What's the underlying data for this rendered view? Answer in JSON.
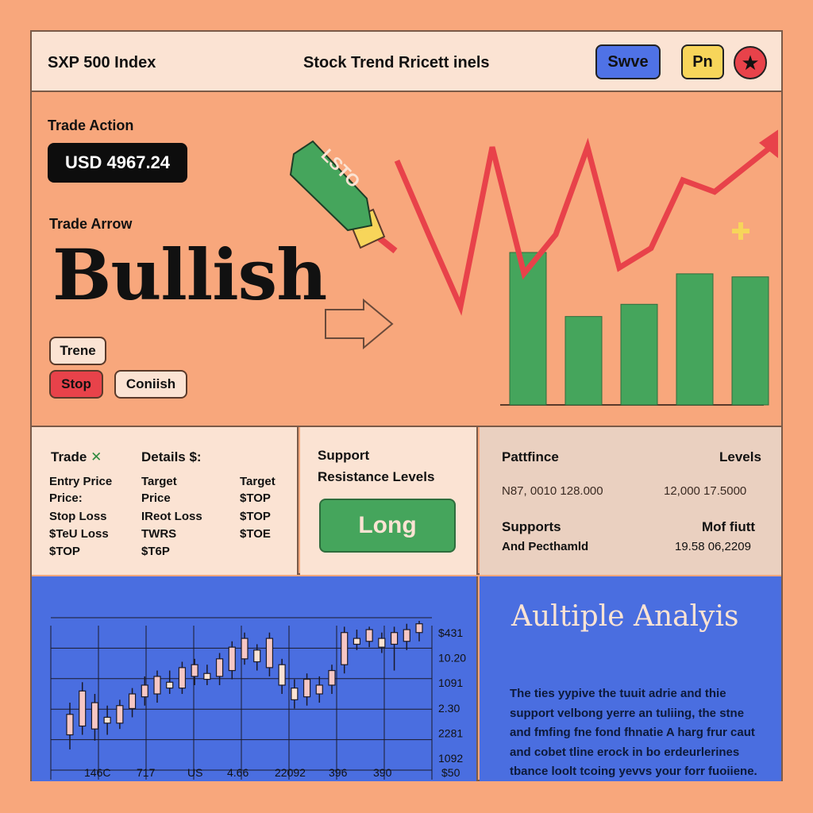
{
  "header": {
    "app_title": "SXP 500 Index",
    "window_title": "Stock Trend Rricett inels",
    "save_label": "Swve",
    "pn_label": "Pn",
    "close_glyph": "★"
  },
  "trade": {
    "action_label": "Trade Action",
    "price": "USD 4967.24",
    "arrow_label": "Trade Arrow",
    "signal": "Bullish",
    "chips": {
      "trend": "Trene",
      "stop": "Stop",
      "confirm": "Coniish"
    },
    "tag_label": "LSTO"
  },
  "details": {
    "col1_header": "Trade",
    "col1_mark": "✕",
    "col2_header": "Details $:",
    "col1": [
      "Entry Price",
      "Price:",
      "Stop Loss",
      "$TeU Loss",
      "$TOP"
    ],
    "col2": [
      "Target",
      "Price",
      "IReot Loss",
      "TWRS",
      "$T6P"
    ],
    "col3": [
      "Target",
      "$TOP",
      "$TOP",
      "$TOE"
    ]
  },
  "support": {
    "title": "Support",
    "subtitle": "Resistance Levels",
    "button_label": "Long"
  },
  "performance": {
    "title_left": "Pattfince",
    "title_right": "Levels",
    "row1_left": "N87, 0010  128.000",
    "row1_right": "12,000  17.5000",
    "label1": "Supports",
    "label2": "And Pecthamld",
    "label_right": "Mof fiutt",
    "value_right": "19.58 06,2209"
  },
  "analysis": {
    "title": "Aultiple Analyis",
    "body": "The ties yypive the tuuit adrie and thie support velbong yerre an tuliing, the stne and fmfing fne fond fhnatie A harg frur caut and cobet tline erock in bo erdeurlerines tbance loolt tcoing yevvs your forr fuoiiene."
  },
  "colors": {
    "background": "#f8a77c",
    "panel_light": "#fbe3d3",
    "panel_blue": "#4a6ee0",
    "bull_green": "#45a55c",
    "bear_red": "#e8424a",
    "accent_yellow": "#f7d55a"
  },
  "chart_data": [
    {
      "type": "bar",
      "series": [
        {
          "values": [
            100,
            58,
            66,
            86,
            84
          ]
        }
      ],
      "line": [
        0.88,
        0.5,
        0.13,
        0.95,
        0.3,
        0.5,
        0.95,
        0.33,
        0.43,
        0.78,
        0.72,
        0.85,
        0.98
      ],
      "ylim": [
        0,
        100
      ]
    },
    {
      "type": "candlestick",
      "y_ticks": [
        "$431",
        "10.20",
        "1091",
        "2.30",
        "2281",
        "1092"
      ],
      "x_ticks": [
        "146C",
        "717",
        "US",
        "4.66",
        "22092",
        "396",
        "390",
        "$50"
      ],
      "candles": [
        [
          0.22,
          0.36,
          0.12,
          0.44
        ],
        [
          0.28,
          0.52,
          0.22,
          0.58
        ],
        [
          0.26,
          0.44,
          0.18,
          0.5
        ],
        [
          0.34,
          0.3,
          0.22,
          0.42
        ],
        [
          0.3,
          0.42,
          0.26,
          0.46
        ],
        [
          0.4,
          0.5,
          0.34,
          0.54
        ],
        [
          0.48,
          0.56,
          0.42,
          0.62
        ],
        [
          0.5,
          0.62,
          0.44,
          0.66
        ],
        [
          0.58,
          0.54,
          0.5,
          0.66
        ],
        [
          0.54,
          0.68,
          0.5,
          0.72
        ],
        [
          0.62,
          0.7,
          0.56,
          0.74
        ],
        [
          0.64,
          0.6,
          0.56,
          0.7
        ],
        [
          0.62,
          0.74,
          0.56,
          0.78
        ],
        [
          0.66,
          0.82,
          0.6,
          0.86
        ],
        [
          0.74,
          0.88,
          0.7,
          0.92
        ],
        [
          0.8,
          0.72,
          0.66,
          0.84
        ],
        [
          0.68,
          0.88,
          0.62,
          0.92
        ],
        [
          0.7,
          0.56,
          0.5,
          0.74
        ],
        [
          0.54,
          0.46,
          0.4,
          0.6
        ],
        [
          0.48,
          0.6,
          0.42,
          0.64
        ],
        [
          0.5,
          0.56,
          0.44,
          0.62
        ],
        [
          0.56,
          0.66,
          0.5,
          0.7
        ],
        [
          0.7,
          0.92,
          0.64,
          0.96
        ],
        [
          0.88,
          0.84,
          0.8,
          0.94
        ],
        [
          0.86,
          0.94,
          0.82,
          0.96
        ],
        [
          0.88,
          0.82,
          0.78,
          0.92
        ],
        [
          0.84,
          0.92,
          0.66,
          0.96
        ],
        [
          0.86,
          0.94,
          0.8,
          0.98
        ],
        [
          0.92,
          0.98,
          0.86,
          1.0
        ]
      ]
    }
  ]
}
